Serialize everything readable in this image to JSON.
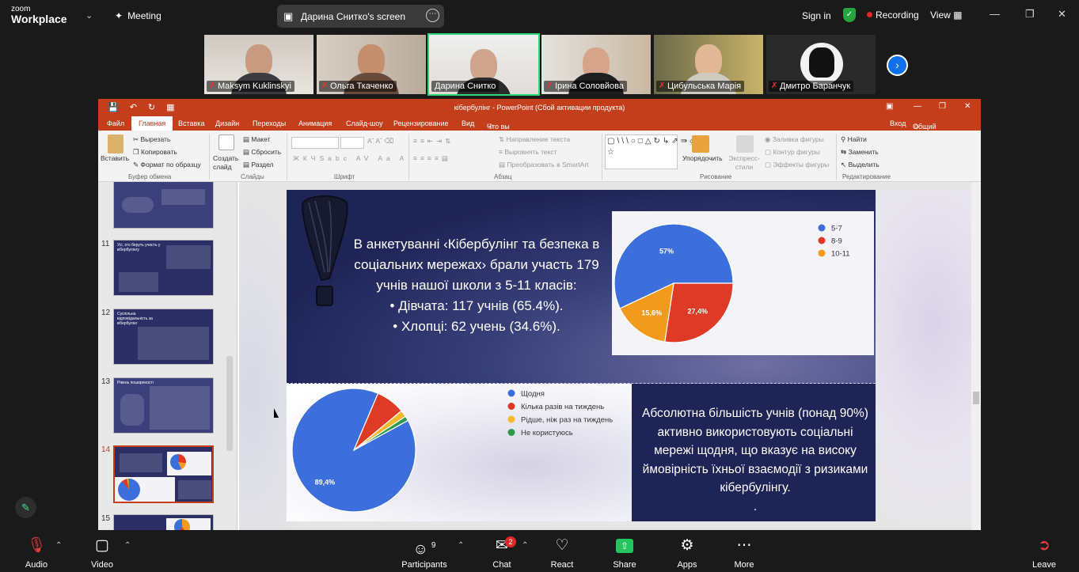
{
  "zoom": {
    "brand_small": "zoom",
    "brand_big": "Workplace",
    "meeting_label": "Meeting",
    "screen_share_label": "Дарина Снитко's screen",
    "sign_in": "Sign in",
    "recording": "Recording",
    "view": "View",
    "participants": [
      {
        "name": "Maksym Kuklinskyi",
        "active": false
      },
      {
        "name": "Ольга Ткаченко",
        "active": false
      },
      {
        "name": "Дарина Снитко",
        "active": true
      },
      {
        "name": "Ірина Соловйова",
        "active": false
      },
      {
        "name": "Цибульська Марія",
        "active": false
      },
      {
        "name": "Дмитро Баранчук",
        "active": false
      }
    ],
    "toolbar": {
      "audio": "Audio",
      "video": "Video",
      "participants_count": "9",
      "participants": "Participants",
      "chat": "Chat",
      "chat_badge": "2",
      "react": "React",
      "share": "Share",
      "apps": "Apps",
      "more": "More",
      "leave": "Leave"
    }
  },
  "ppt": {
    "title": "кібербулінг - PowerPoint (Сбой активации продукта)",
    "tabs": [
      "Файл",
      "Главная",
      "Вставка",
      "Дизайн",
      "Переходы",
      "Анимация",
      "Слайд-шоу",
      "Рецензирование",
      "Вид"
    ],
    "tell_me": "Что вы хотите сделать?",
    "signin": "Вход",
    "share": "Общий доступ",
    "ribbon": {
      "paste": "Вставить",
      "cut": "Вырезать",
      "copy": "Копировать",
      "format_painter": "Формат по образцу",
      "clipboard": "Буфер обмена",
      "new_slide": "Создать слайд",
      "layout": "Макет",
      "reset": "Сбросить",
      "section": "Раздел",
      "slides": "Слайды",
      "font": "Шрифт",
      "text_direction": "Направление текста",
      "align_text": "Выровнять текст",
      "smartart": "Преобразовать в SmartArt",
      "paragraph": "Абзац",
      "arrange": "Упорядочить",
      "quick_styles": "Экспресс-стили",
      "shape_fill": "Заливка фигуры",
      "shape_outline": "Контур фигуры",
      "shape_effects": "Эффекты фигуры",
      "drawing": "Рисование",
      "find": "Найти",
      "replace": "Заменить",
      "select": "Выделить",
      "editing": "Редактирование"
    },
    "thumbnails": [
      {
        "num": "",
        "title": ""
      },
      {
        "num": "11",
        "title": "Усі, хто беруть участь у кібербулінгу"
      },
      {
        "num": "12",
        "title": "Суспільна відповідальність за кібербулінг"
      },
      {
        "num": "13",
        "title": "Рівень поширеності"
      },
      {
        "num": "14",
        "title": ""
      },
      {
        "num": "15",
        "title": ""
      }
    ],
    "selected_slide": "14"
  },
  "slide": {
    "text_top": [
      "В анкетуванні ‹Кібербулінг та безпека в",
      "соціальних мережах› брали участь 179",
      "учнів нашої школи з 5-11 класів:",
      "• Дівчата: 117 учнів (65.4%).",
      "•  Хлопці: 62 учень (34.6%)."
    ],
    "text_bottom": [
      "Абсолютна більшість учнів (понад 90%)",
      "активно використовують соціальні",
      "мережі щодня, що вказує на високу",
      "ймовірність їхньої взаємодії з ризиками",
      "кібербулінгу.",
      "."
    ]
  },
  "chart_data": [
    {
      "type": "pie",
      "categories": [
        "5-7",
        "8-9",
        "10-11"
      ],
      "values": [
        57,
        27.4,
        15.6
      ],
      "data_labels": [
        "57%",
        "27,4%",
        "15,6%"
      ],
      "colors": [
        "#3d6fdc",
        "#de3a25",
        "#f29a1c"
      ],
      "legend": "right"
    },
    {
      "type": "pie",
      "categories": [
        "Щодня",
        "Кілька разів на тиждень",
        "Рідше, ніж раз на тиждень",
        "Не користуюсь"
      ],
      "values": [
        89.4,
        7.6,
        1.8,
        1.2
      ],
      "data_labels": [
        "89,4%"
      ],
      "colors": [
        "#3d6fdc",
        "#de3a25",
        "#f5b92b",
        "#2f9a4a"
      ],
      "legend": "right"
    }
  ]
}
